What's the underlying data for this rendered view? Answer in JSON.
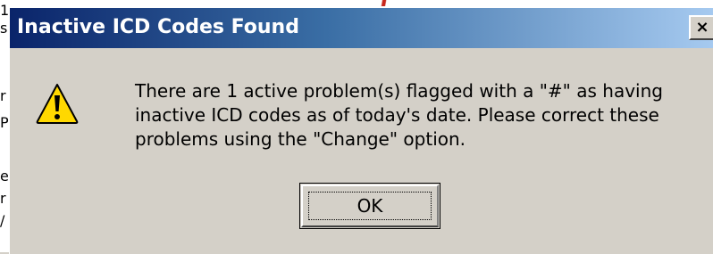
{
  "background": {
    "fragments": [
      "1",
      "s",
      "r",
      "P",
      "e",
      "r",
      "/"
    ]
  },
  "dialog": {
    "title": "Inactive ICD Codes Found",
    "close_label": "×",
    "icon": "warning-icon",
    "message_lines": [
      "There are 1 active problem(s) flagged with a \"#\" as having",
      "inactive ICD codes as of today's date.  Please correct these",
      "problems using the \"Change\" option."
    ],
    "ok_label": "OK"
  },
  "colors": {
    "title_start": "#0a246a",
    "title_end": "#a6caf0",
    "face": "#d4d0c8",
    "warning_yellow": "#ffd800"
  }
}
